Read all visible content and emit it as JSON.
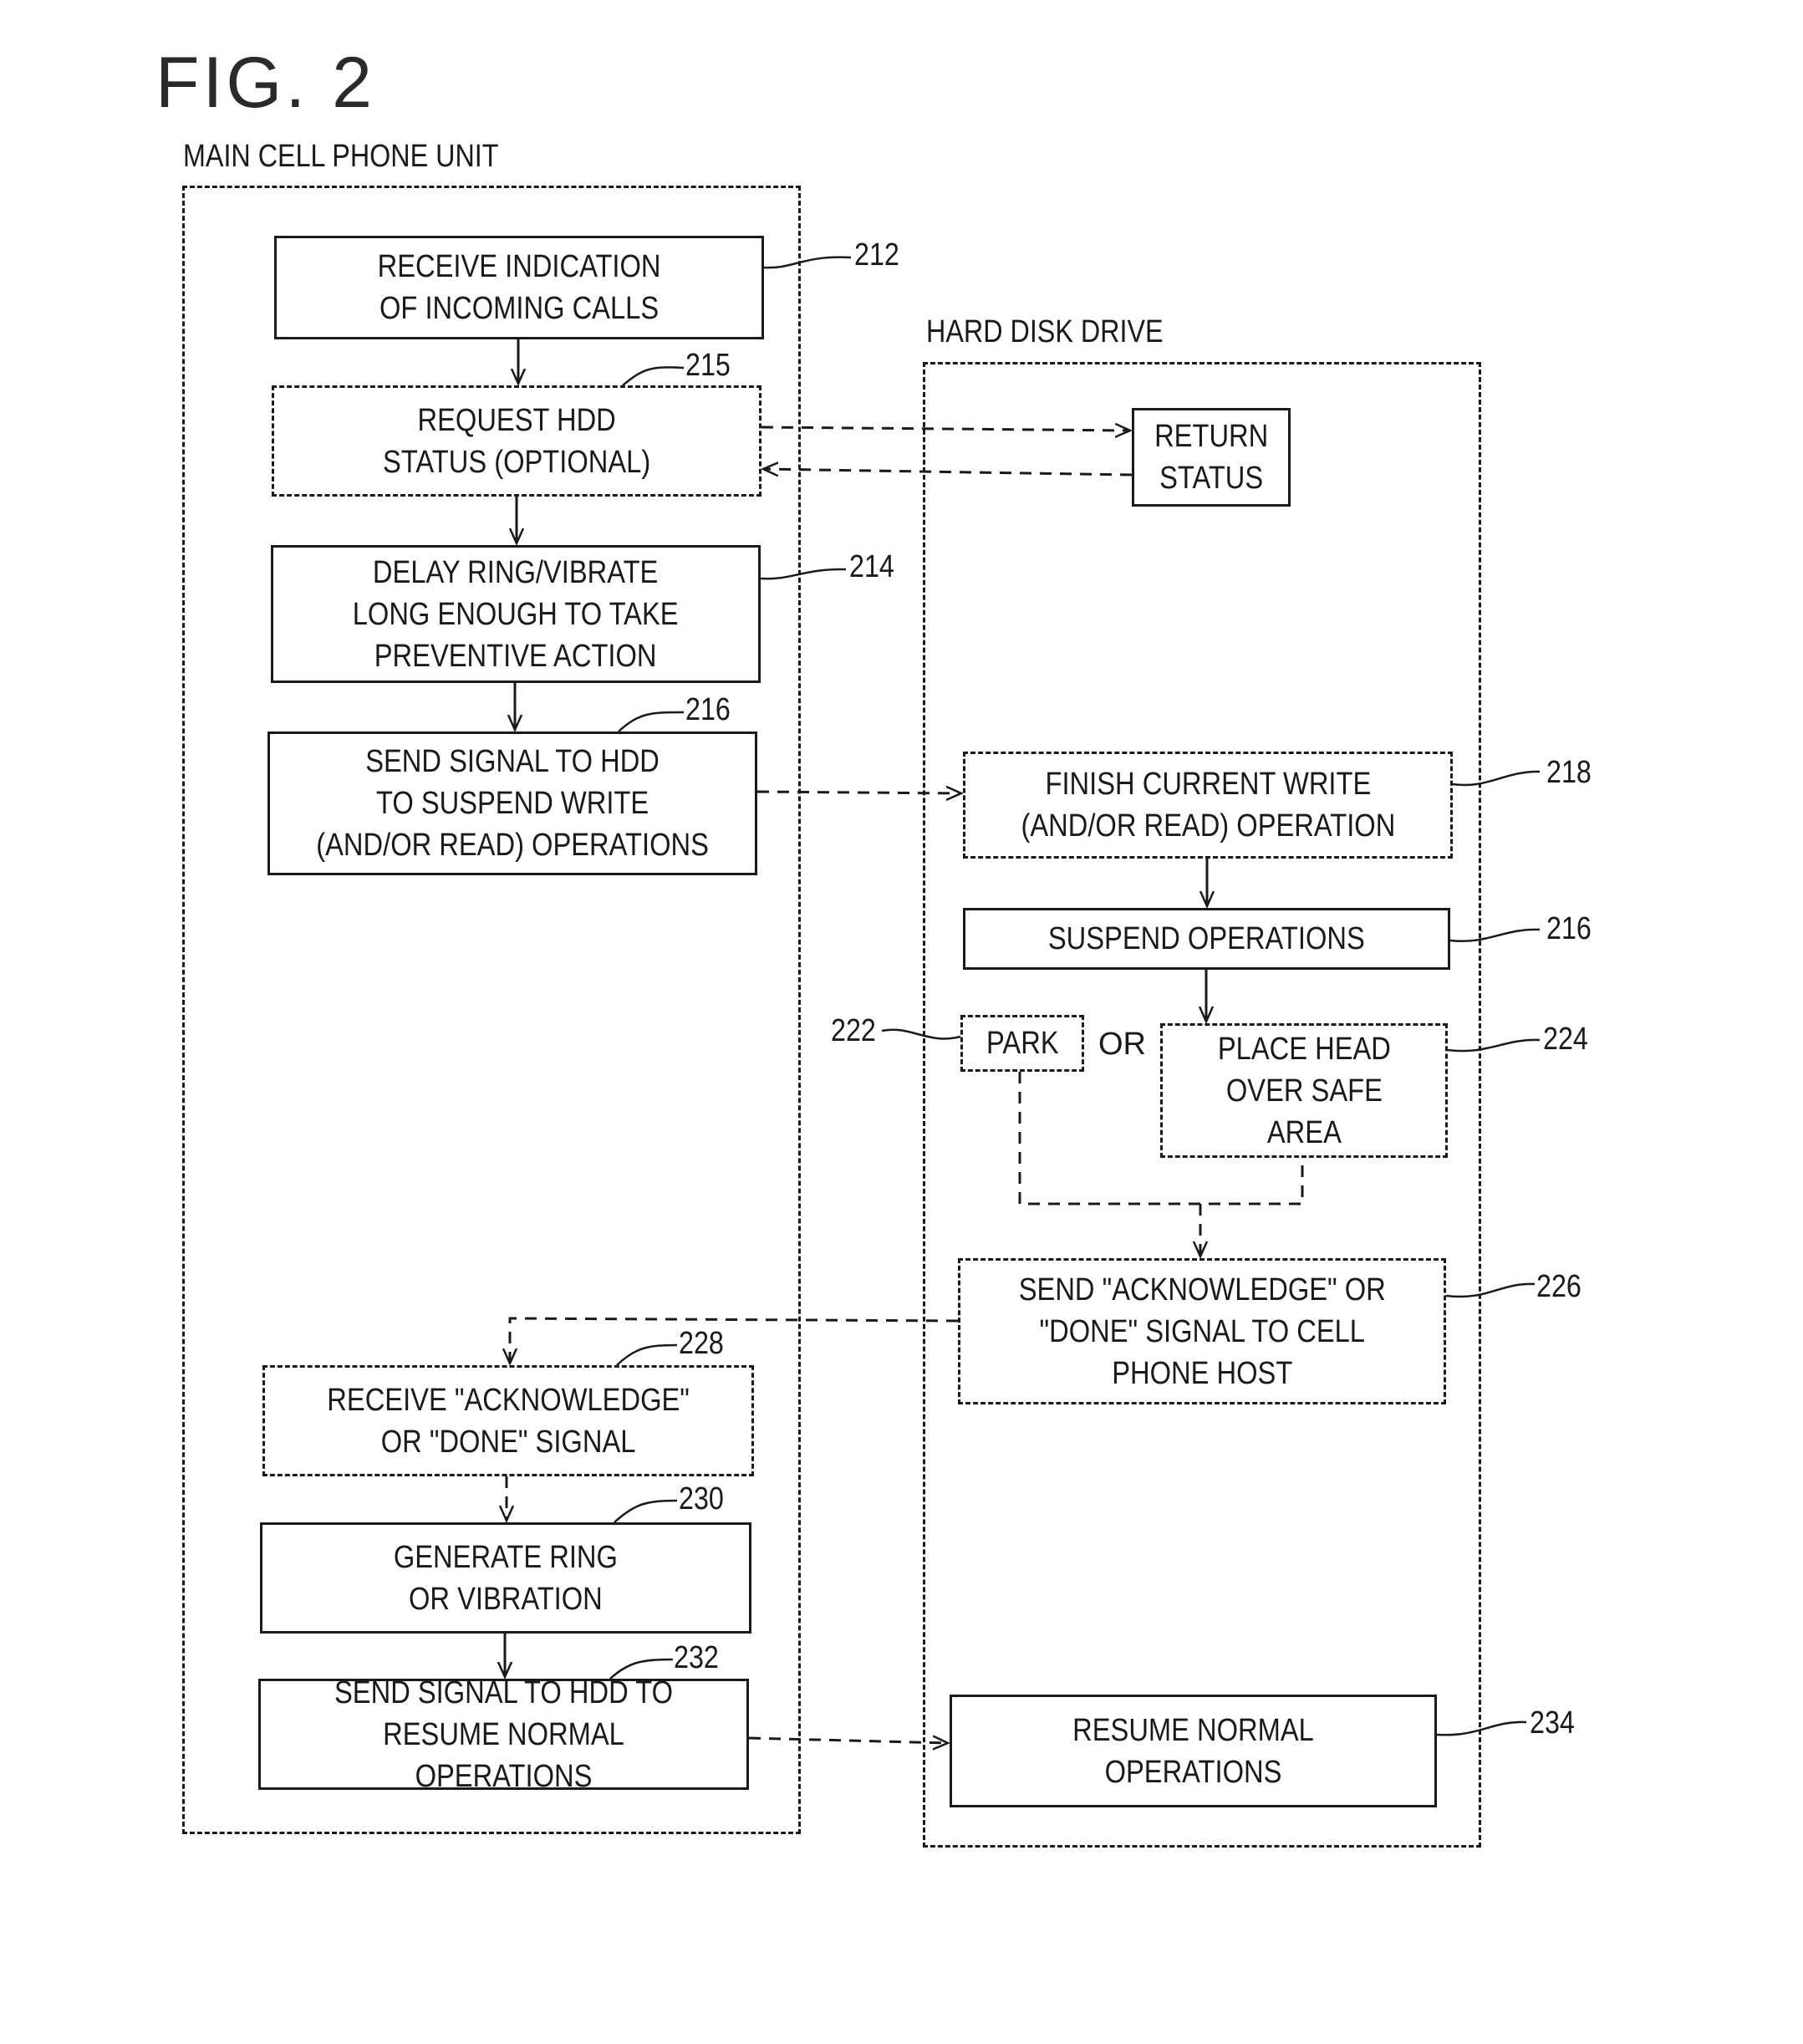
{
  "figure": {
    "title": "FIG. 2"
  },
  "sections": {
    "main_unit": {
      "label": "MAIN CELL PHONE UNIT"
    },
    "hdd": {
      "label": "HARD DISK DRIVE"
    }
  },
  "steps": {
    "s212": {
      "ref": "212",
      "text": "RECEIVE INDICATION\nOF INCOMING CALLS",
      "style": "solid"
    },
    "s215": {
      "ref": "215",
      "text": "REQUEST HDD\nSTATUS  (OPTIONAL)",
      "style": "dashed"
    },
    "s214": {
      "ref": "214",
      "text": "DELAY RING/VIBRATE\nLONG ENOUGH TO TAKE\nPREVENTIVE ACTION",
      "style": "solid"
    },
    "s216a": {
      "ref": "216",
      "text": "SEND SIGNAL TO HDD\nTO SUSPEND WRITE\n(AND/OR READ) OPERATIONS",
      "style": "solid"
    },
    "return_status": {
      "text": "RETURN\nSTATUS",
      "style": "solid"
    },
    "s218": {
      "ref": "218",
      "text": "FINISH CURRENT WRITE\n(AND/OR READ) OPERATION",
      "style": "dashed"
    },
    "s216b": {
      "ref": "216",
      "text": "SUSPEND OPERATIONS",
      "style": "solid"
    },
    "s222": {
      "ref": "222",
      "text": "PARK",
      "style": "dashed"
    },
    "or_label": "OR",
    "s224": {
      "ref": "224",
      "text": "PLACE HEAD\nOVER SAFE\nAREA",
      "style": "dashed"
    },
    "s226": {
      "ref": "226",
      "text": "SEND \"ACKNOWLEDGE\" OR\n\"DONE\" SIGNAL TO CELL\nPHONE HOST",
      "style": "dashed"
    },
    "s228": {
      "ref": "228",
      "text": "RECEIVE \"ACKNOWLEDGE\"\nOR \"DONE\" SIGNAL",
      "style": "dashed"
    },
    "s230": {
      "ref": "230",
      "text": "GENERATE RING\nOR VIBRATION",
      "style": "solid"
    },
    "s232": {
      "ref": "232",
      "text": "SEND SIGNAL TO HDD TO\nRESUME NORMAL OPERATIONS",
      "style": "solid"
    },
    "s234": {
      "ref": "234",
      "text": "RESUME NORMAL OPERATIONS",
      "style": "solid"
    }
  },
  "flows": [
    {
      "from": "212",
      "to": "215",
      "type": "solid"
    },
    {
      "from": "215",
      "to": "214",
      "type": "solid"
    },
    {
      "from": "214",
      "to": "216",
      "type": "solid"
    },
    {
      "from": "215",
      "to": "RETURN STATUS",
      "type": "dashed"
    },
    {
      "from": "RETURN STATUS",
      "to": "215",
      "type": "dashed"
    },
    {
      "from": "216",
      "to": "218",
      "type": "dashed"
    },
    {
      "from": "218",
      "to": "216 (SUSPEND OPERATIONS)",
      "type": "solid"
    },
    {
      "from": "216 (SUSPEND OPERATIONS)",
      "to": "222/224",
      "type": "solid"
    },
    {
      "from": "222/224",
      "to": "226",
      "type": "dashed"
    },
    {
      "from": "226",
      "to": "228",
      "type": "dashed"
    },
    {
      "from": "228",
      "to": "230",
      "type": "dashed"
    },
    {
      "from": "230",
      "to": "232",
      "type": "solid"
    },
    {
      "from": "232",
      "to": "234",
      "type": "dashed"
    }
  ]
}
